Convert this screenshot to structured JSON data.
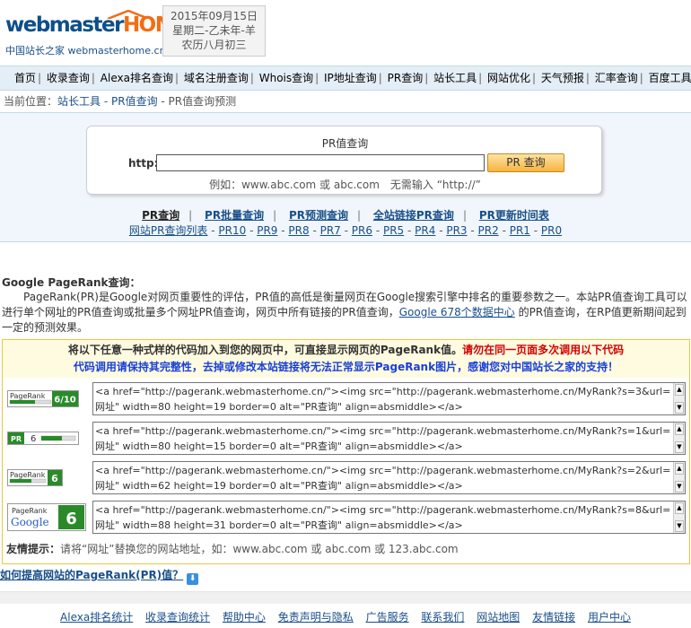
{
  "logo": {
    "word_a": "webmaster",
    "word_b": "HOME",
    "tagline": "中国站长之家 webmasterhome.cn"
  },
  "date": {
    "line1": "2015年09月15日",
    "line2": "星期二-乙未年-羊",
    "line3": "农历八月初三"
  },
  "nav": [
    "首页",
    "收录查询",
    "Alexa排名查询",
    "域名注册查询",
    "Whois查询",
    "IP地址查询",
    "PR查询",
    "站长工具",
    "网站优化",
    "天气预报",
    "汇率查询",
    "百度工具"
  ],
  "breadcrumb": {
    "prefix": "当前位置：",
    "items": [
      "站长工具",
      "PR值查询",
      "PR值查询预测"
    ],
    "sep": " - "
  },
  "query": {
    "title": "PR值查询",
    "label": "http://",
    "input_value": "",
    "button": "PR 查询",
    "example": "例如：www.abc.com 或 abc.com　无需输入 “http://”"
  },
  "tabs": [
    "PR查询",
    "PR批量查询",
    "PR预测查询",
    "全站链接PR查询",
    "PR更新时间表"
  ],
  "pr_list": {
    "first": "网站PR查询列表",
    "items": [
      "PR10",
      "PR9",
      "PR8",
      "PR7",
      "PR6",
      "PR5",
      "PR4",
      "PR3",
      "PR2",
      "PR1",
      "PR0"
    ]
  },
  "intro": {
    "title": "Google PageRank查询：",
    "text_a": "PageRank(PR)是Google对网页重要性的评估，PR值的高低是衡量网页在Google搜索引擎中排名的重要参数之一。本站PR值查询工具可以进行单个网址的PR值查询或批量多个网址PR值查询，网页中所有链接的PR值查询，",
    "link": "Google 678个数据中心",
    "text_b": " 的PR值查询，在RP值更新期间起到一定的预测效果。"
  },
  "code": {
    "head1": "将以下任意一种式样的代码加入到您的网页中，可直接显示网页的PageRank值。",
    "head1_red": "请勿在同一页面多次调用以下代码",
    "head2": "代码调用请保持其完整性，去掉或修改本站链接将无法正常显示PageRank图片，感谢您对中国站长之家的支持！",
    "rows": [
      {
        "badge": "PageRank 6/10",
        "code": "<a href=\"http://pagerank.webmasterhome.cn/\"><img src=\"http://pagerank.webmasterhome.cn/MyRank?s=3&url=网址\" width=80 height=19 border=0 alt=\"PR查询\" align=absmiddle></a>"
      },
      {
        "badge": "PR 6",
        "code": "<a href=\"http://pagerank.webmasterhome.cn/\"><img src=\"http://pagerank.webmasterhome.cn/MyRank?s=1&url=网址\" width=80 height=15 border=0 alt=\"PR查询\" align=absmiddle></a>"
      },
      {
        "badge": "PageRank 6",
        "code": "<a href=\"http://pagerank.webmasterhome.cn/\"><img src=\"http://pagerank.webmasterhome.cn/MyRank?s=2&url=网址\" width=62 height=19 border=0 alt=\"PR查询\" align=absmiddle></a>"
      },
      {
        "badge": "PageRank Google 6",
        "code": "<a href=\"http://pagerank.webmasterhome.cn/\"><img src=\"http://pagerank.webmasterhome.cn/MyRank?s=8&url=网址\" width=88 height=31 border=0 alt=\"PR查询\" align=absmiddle></a>"
      }
    ],
    "tip_label": "友情提示：",
    "tip_text": "请将“网址”替换您的网站地址，如：www.abc.com 或 abc.com 或 123.abc.com"
  },
  "howto": "如何提高网站的PageRank(PR)值？",
  "footer": [
    "Alexa排名统计",
    "收录查询统计",
    "帮助中心",
    "免责声明与隐私",
    "广告服务",
    "联系我们",
    "网站地图",
    "友情链接",
    "用户中心"
  ],
  "badge_text": {
    "pagerank": "PageRank",
    "rank_6_10": "6/10",
    "pr": "PR",
    "six": "6",
    "google": "Google"
  },
  "colors": {
    "brand_blue": "#0d4f8a",
    "brand_orange": "#f26d14",
    "link": "#1a4f8a",
    "warning_red": "#d40000",
    "notice_blue": "#1a40d8",
    "pr_green": "#2a8a2a"
  }
}
